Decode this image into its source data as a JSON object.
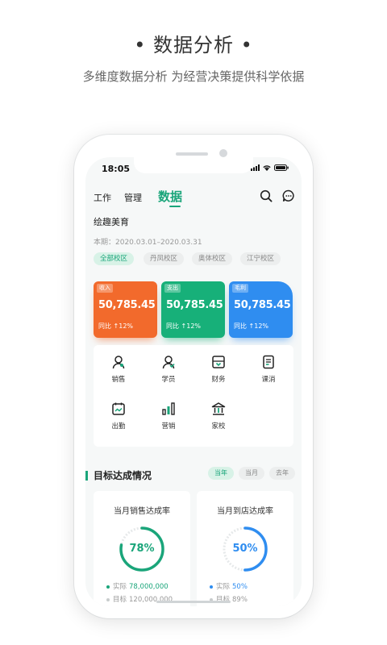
{
  "hero": {
    "title": "• 数据分析 •",
    "subtitle": "多维度数据分析  为经营决策提供科学依据"
  },
  "status_bar": {
    "time": "18:05"
  },
  "nav": {
    "tabs": [
      {
        "label": "工作",
        "active": false
      },
      {
        "label": "管理",
        "active": false
      },
      {
        "label": "数据",
        "active": true
      }
    ],
    "icons": [
      "search-icon",
      "message-icon"
    ]
  },
  "org": {
    "name": "绘趣美育",
    "period": "本期：2020.03.01–2020.03.31"
  },
  "campuses": [
    {
      "label": "全部校区",
      "active": true
    },
    {
      "label": "丹凤校区",
      "active": false
    },
    {
      "label": "奥体校区",
      "active": false
    },
    {
      "label": "江宁校区",
      "active": false
    }
  ],
  "stats": [
    {
      "tag": "收入",
      "value": "50,785.45",
      "yoy": "同比 ↑12%",
      "color": "#f26a2c"
    },
    {
      "tag": "支出",
      "value": "50,785.45",
      "yoy": "同比 ↑12%",
      "color": "#17b079"
    },
    {
      "tag": "毛利",
      "value": "50,785.45",
      "yoy": "同比 ↑12%",
      "color": "#2f8df0"
    }
  ],
  "modules": [
    {
      "label": "销售",
      "icon": "sales-person-icon"
    },
    {
      "label": "学员",
      "icon": "student-icon"
    },
    {
      "label": "财务",
      "icon": "finance-icon"
    },
    {
      "label": "课消",
      "icon": "course-consumption-icon"
    },
    {
      "label": "出勤",
      "icon": "attendance-calendar-icon"
    },
    {
      "label": "营销",
      "icon": "marketing-chart-icon"
    },
    {
      "label": "家校",
      "icon": "home-school-icon"
    }
  ],
  "targets": {
    "title": "目标达成情况",
    "period_tabs": [
      {
        "label": "当年",
        "active": true
      },
      {
        "label": "当月",
        "active": false
      },
      {
        "label": "去年",
        "active": false
      }
    ],
    "cards": [
      {
        "title": "当月销售达成率",
        "percent": 78,
        "percent_label": "78%",
        "color": "#1aa57a",
        "actual_label": "实际",
        "actual_value": "78,000,000",
        "target_label": "目标",
        "target_value": "120,000,000"
      },
      {
        "title": "当月到店达成率",
        "percent": 50,
        "percent_label": "50%",
        "color": "#2f8df0",
        "actual_label": "实际",
        "actual_value": "50%",
        "target_label": "目标",
        "target_value": "89%"
      }
    ]
  },
  "colors": {
    "accent": "#1aa57a",
    "orange": "#f26a2c",
    "green": "#17b079",
    "blue": "#2f8df0"
  }
}
